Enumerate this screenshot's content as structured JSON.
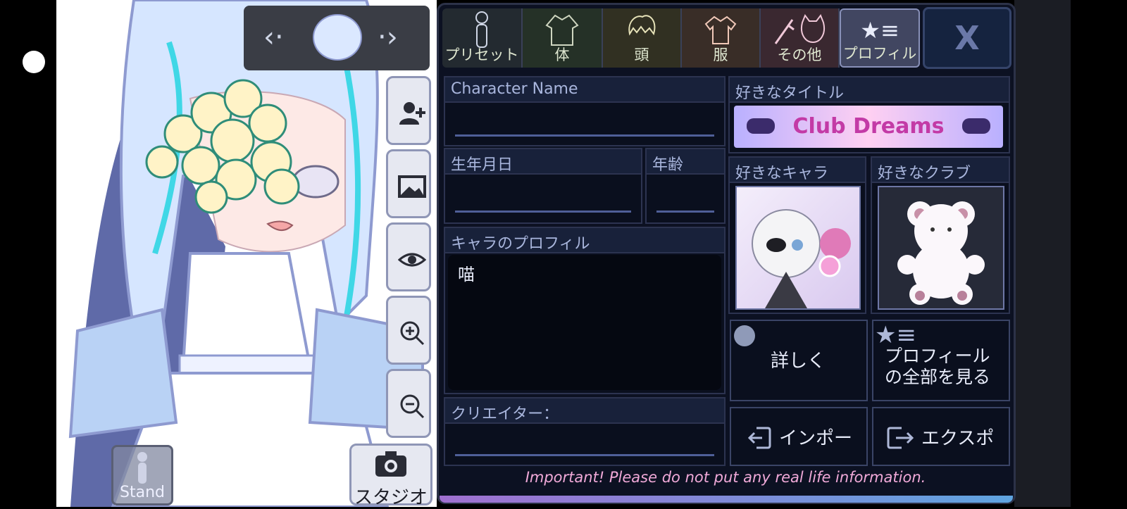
{
  "character_selector": {
    "prev_icon": "chevron-left-icon",
    "next_icon": "chevron-right-icon",
    "avatar_icon": "character-head-icon"
  },
  "left_tools": [
    {
      "icon": "add-user-icon"
    },
    {
      "icon": "image-icon"
    },
    {
      "icon": "eye-icon"
    },
    {
      "icon": "zoom-in-icon"
    },
    {
      "icon": "zoom-out-icon"
    }
  ],
  "stand_label": "Stand",
  "studio_label": "スタジオ",
  "tabs": [
    {
      "label": "プリセット",
      "icon": "mannequin-icon"
    },
    {
      "label": "体",
      "icon": "jacket-icon"
    },
    {
      "label": "頭",
      "icon": "hair-icon"
    },
    {
      "label": "服",
      "icon": "shirt-icon"
    },
    {
      "label": "その他",
      "icon": "sword-cat-icon"
    },
    {
      "label": "プロフィル",
      "icon": "star-list-icon"
    }
  ],
  "close_label": "X",
  "fields": {
    "character_name": {
      "label": "Character Name",
      "value": ""
    },
    "birthday": {
      "label": "生年月日",
      "value": ""
    },
    "age": {
      "label": "年齢",
      "value": ""
    },
    "profile": {
      "label": "キャラのプロフィル",
      "value": "喵"
    },
    "creator": {
      "label": "クリエイター：",
      "value": ""
    }
  },
  "favorites": {
    "title": {
      "label": "好きなタイトル",
      "banner_text": "Club Dreams"
    },
    "character": {
      "label": "好きなキャラ"
    },
    "club": {
      "label": "好きなクラブ"
    }
  },
  "buttons": {
    "details": "詳しく",
    "full_profile_line1": "プロフィール",
    "full_profile_line2": "の全部を見る",
    "import": "インポー",
    "export": "エクスポ"
  },
  "notice": "Important! Please do not put any real life information.",
  "colors": {
    "panel_bg": "#0c1122",
    "accent_text": "#a9b6dd",
    "notice": "#f0a9d8"
  }
}
